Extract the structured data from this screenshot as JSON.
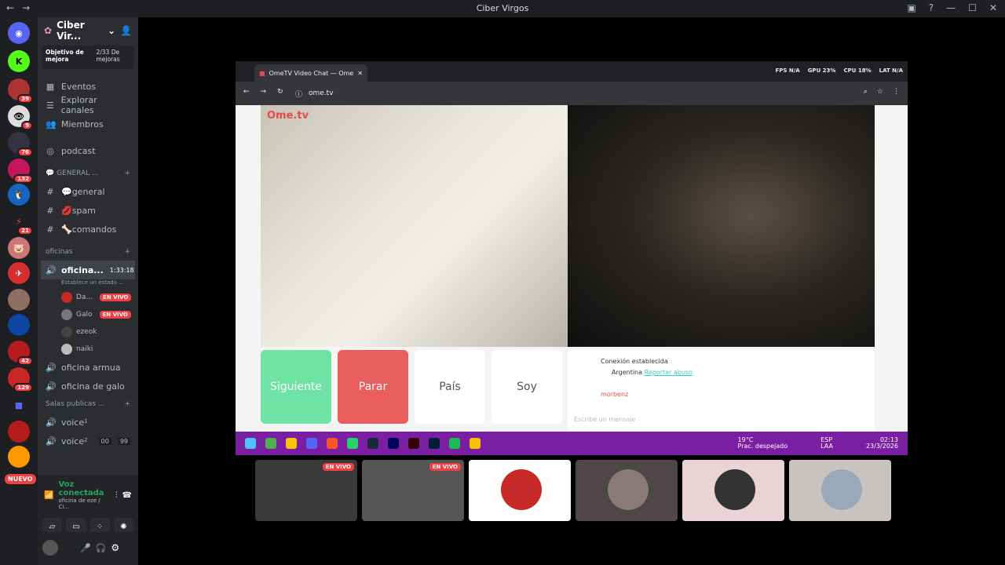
{
  "window": {
    "title": "Ciber Virgos"
  },
  "servers": {
    "badges": [
      "39",
      "9",
      "76",
      "132",
      "21",
      "42",
      "129"
    ],
    "nuevo": "NUEVO"
  },
  "guild": {
    "name": "Ciber Vir...",
    "goal_label": "Objetivo de mejora",
    "goal_value": "2/33 De mejoras"
  },
  "nav": [
    {
      "label": "Eventos",
      "icon": "calendar-icon"
    },
    {
      "label": "Explorar canales",
      "icon": "list-icon"
    },
    {
      "label": "Miembros",
      "icon": "members-icon"
    }
  ],
  "podcast": "podcast",
  "general_category": "💬 GENERAL ...",
  "text_channels": [
    "💬general",
    "💋spam",
    "🦴comandos"
  ],
  "voice_category": "oficinas",
  "voice_active": {
    "name": "oficina...",
    "timer": "1:33:18",
    "status": "Establece un estado ..."
  },
  "voice_users": [
    {
      "name": "Da...",
      "live": "EN VIVO"
    },
    {
      "name": "Galo",
      "live": "EN VIVO"
    },
    {
      "name": "ezeok",
      "live": ""
    },
    {
      "name": "naiki",
      "live": ""
    }
  ],
  "voice_channels": [
    "oficina armua",
    "oficina de galo"
  ],
  "public_category": "Salas publicas ...",
  "public_channels": [
    "voice¹",
    "voice²"
  ],
  "public_counts": [
    "00",
    "99"
  ],
  "voice_connected": {
    "label": "Voz conectada",
    "sub": "oficina de eze / Ci..."
  },
  "browser": {
    "tab": "OmeTV Video Chat — Ome",
    "url": "ome.tv",
    "fps": "FPS N/A",
    "gpu": "GPU 23%",
    "cpu": "CPU 18%",
    "lat": "LAT N/A"
  },
  "ome": {
    "logo": "Ome.tv",
    "next": "Siguiente",
    "stop": "Parar",
    "country": "País",
    "sex": "Soy",
    "conn": "Conexión establecida",
    "country_name": "Argentina",
    "report": "Reportar abuso",
    "user": "morbenz",
    "placeholder": "Escribe un mensaje"
  },
  "taskbar": {
    "weather_temp": "19°C",
    "weather": "Prac. despejado",
    "lang1": "ESP",
    "lang2": "LAA",
    "time": "02:13",
    "date": "23/3/2026"
  },
  "thumb_live": "EN VIVO"
}
